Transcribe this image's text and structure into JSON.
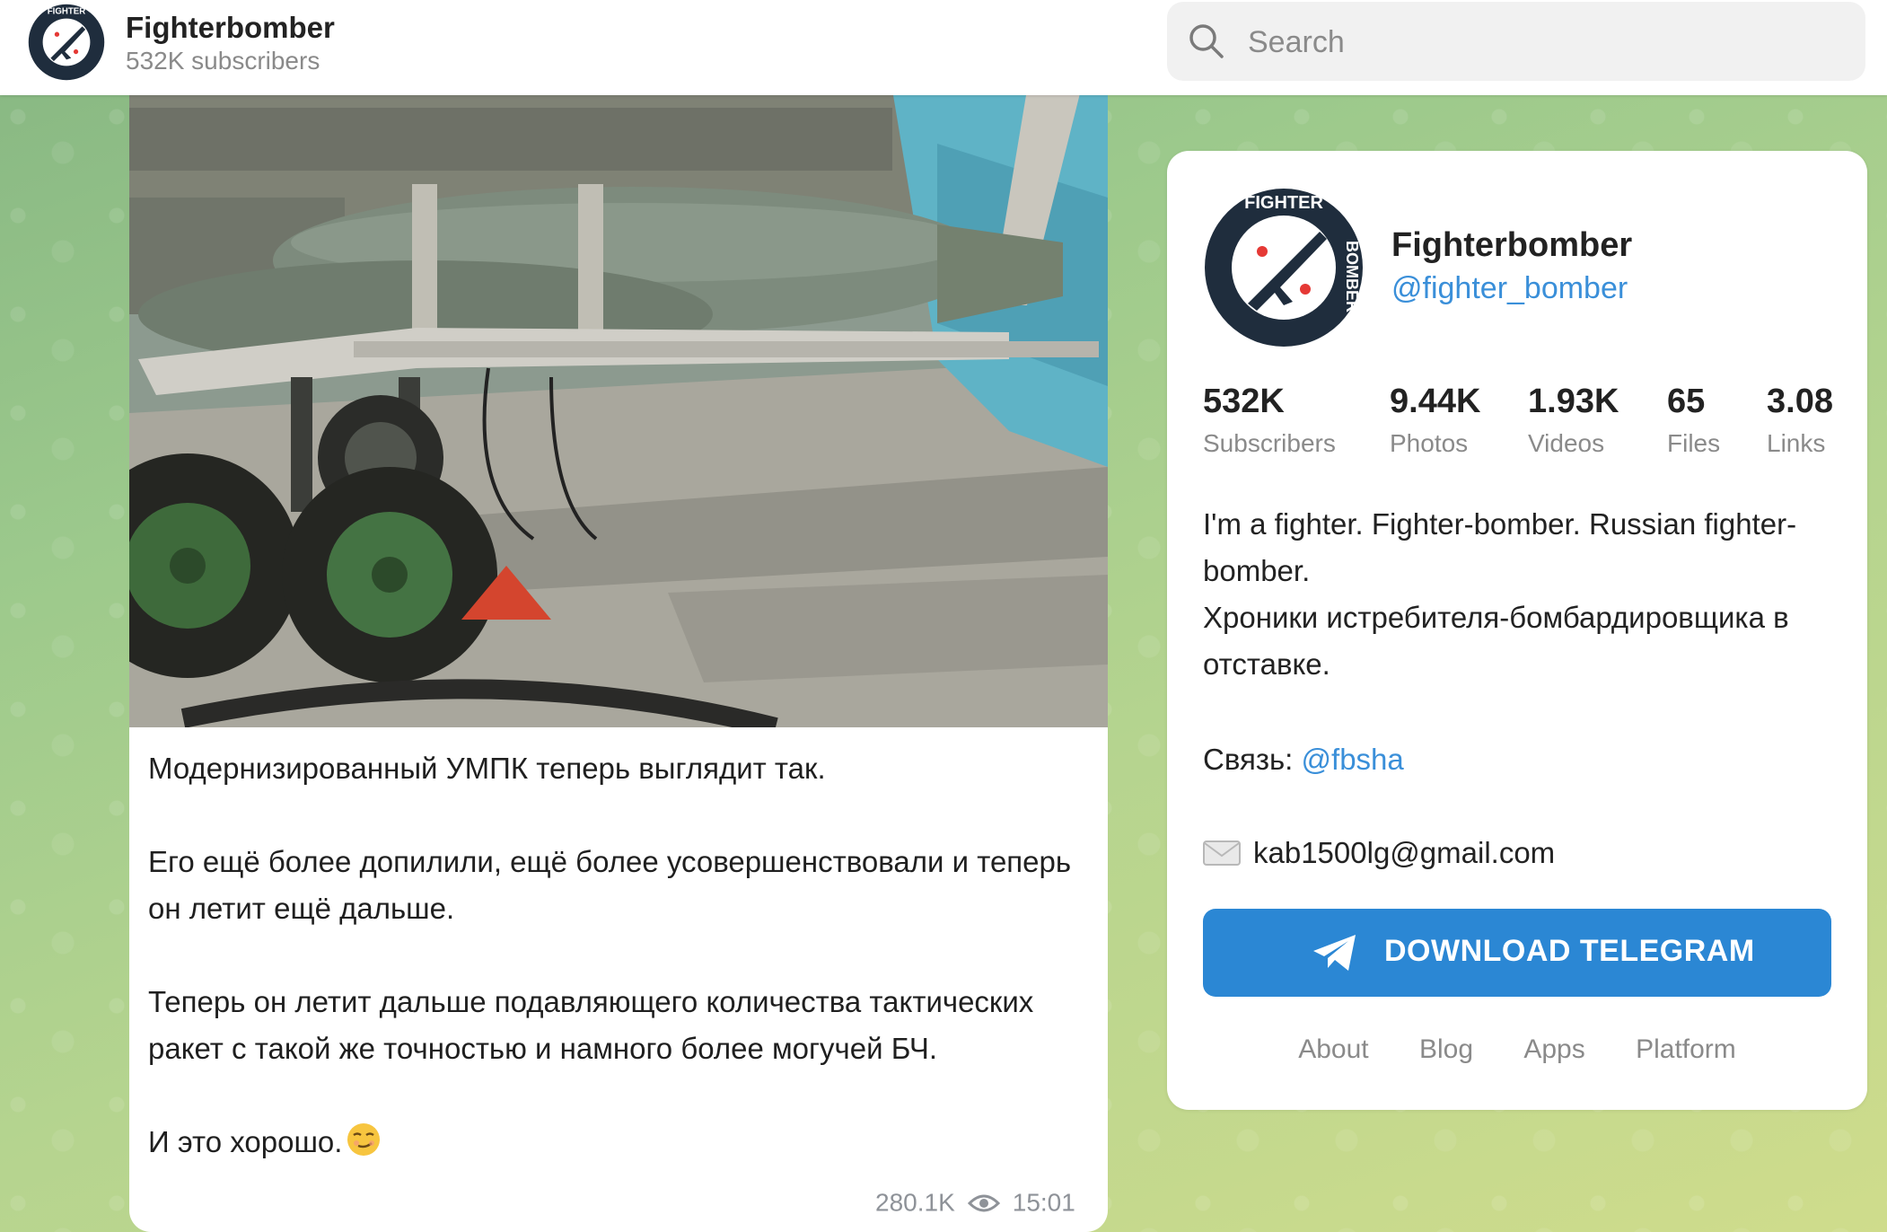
{
  "header": {
    "channel_name": "Fighterbomber",
    "subscribers": "532K subscribers"
  },
  "search": {
    "placeholder": "Search"
  },
  "message": {
    "paragraphs": [
      "Модернизированный УМПК теперь выглядит так.",
      "Его ещё более допилили, ещё более усовершенствовали и теперь он летит ещё дальше.",
      "Теперь он летит дальше подавляющего количества тактических ракет с такой же точностью и намного более могучей БЧ.",
      "И это хорошо."
    ],
    "views": "280.1K",
    "time": "15:01"
  },
  "channel": {
    "name": "Fighterbomber",
    "handle": "@fighter_bomber",
    "avatar_text": "FIGHTERBOMBER",
    "stats": [
      {
        "value": "532K",
        "label": "Subscribers"
      },
      {
        "value": "9.44K",
        "label": "Photos"
      },
      {
        "value": "1.93K",
        "label": "Videos"
      },
      {
        "value": "65",
        "label": "Files"
      },
      {
        "value": "3.08",
        "label": "Links"
      }
    ],
    "description": [
      "I'm a fighter. Fighter-bomber. Russian fighter-bomber.",
      "Хроники истребителя-бомбардировщика в отставке."
    ],
    "contact_label": "Связь:",
    "contact_link": "@fbsha",
    "email": "kab1500lg@gmail.com",
    "download_label": "DOWNLOAD TELEGRAM"
  },
  "footer": {
    "links": [
      "About",
      "Blog",
      "Apps",
      "Platform"
    ]
  },
  "colors": {
    "accent": "#2b87d4",
    "link": "#3a8fd9",
    "avatar_bg": "#1f2d3d"
  },
  "icons": [
    "search-icon",
    "eye-icon",
    "mail-icon",
    "telegram-plane-icon",
    "smirk-emoji"
  ]
}
